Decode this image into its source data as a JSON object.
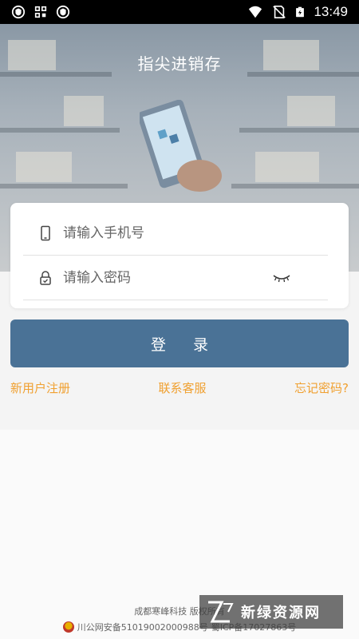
{
  "status_bar": {
    "time": "13:49",
    "left_icons": [
      "shield-icon",
      "grid-icon",
      "shield-icon"
    ],
    "right_icons": [
      "wifi-icon",
      "no-sim-icon",
      "battery-charging-icon"
    ]
  },
  "hero": {
    "title": "指尖进销存"
  },
  "login": {
    "phone_placeholder": "请输入手机号",
    "password_placeholder": "请输入密码",
    "button_label": "登 录"
  },
  "links": {
    "register": "新用户注册",
    "support": "联系客服",
    "forgot": "忘记密码?"
  },
  "footer": {
    "company": "成都寒峰科技 版权所有",
    "police_record": "川公网安备51019002000988号",
    "icp": "蜀ICP备17027863号"
  },
  "watermark": {
    "text": "新绿资源网"
  },
  "colors": {
    "primary": "#4a7296",
    "link": "#f0a030",
    "background": "#f4f4f4"
  }
}
